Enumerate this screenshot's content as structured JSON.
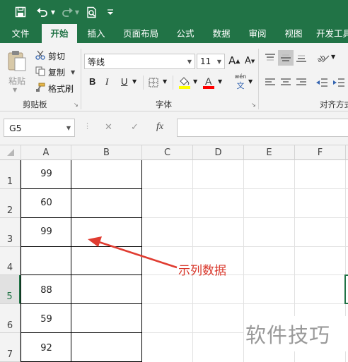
{
  "qat": {
    "save_icon": "save-icon",
    "undo_icon": "undo-icon",
    "redo_icon": "redo-icon",
    "print_preview_icon": "print-preview-icon",
    "customize_icon": "customize-qat-icon"
  },
  "tabs": [
    "文件",
    "开始",
    "插入",
    "页面布局",
    "公式",
    "数据",
    "审阅",
    "视图",
    "开发工具"
  ],
  "active_tab": "开始",
  "clipboard": {
    "paste": "粘贴",
    "cut": "剪切",
    "copy": "复制",
    "format_painter": "格式刷",
    "group": "剪贴板"
  },
  "font": {
    "name": "等线",
    "size": "11",
    "bold": "B",
    "italic": "I",
    "underline": "U",
    "grow": "A",
    "shrink": "A",
    "fill_color": "#FFFF00",
    "font_color": "#FF0000",
    "phonetic": "wén",
    "group": "字体"
  },
  "alignment": {
    "group": "对齐方式"
  },
  "formula_bar": {
    "name_box": "G5",
    "cancel": "✕",
    "enter": "✓",
    "fx": "fx",
    "value": ""
  },
  "columns": [
    "A",
    "B",
    "C",
    "D",
    "E",
    "F"
  ],
  "rows": [
    "1",
    "2",
    "3",
    "4",
    "5",
    "6",
    "7"
  ],
  "selected_row": "5",
  "column_a": [
    "99",
    "60",
    "99",
    "",
    "88",
    "59",
    "92"
  ],
  "annotation": "示列数据",
  "watermark": "软件技巧",
  "colors": {
    "excel_green": "#217346",
    "arrow_red": "#e03c31",
    "annotation_red": "#d9382c"
  }
}
